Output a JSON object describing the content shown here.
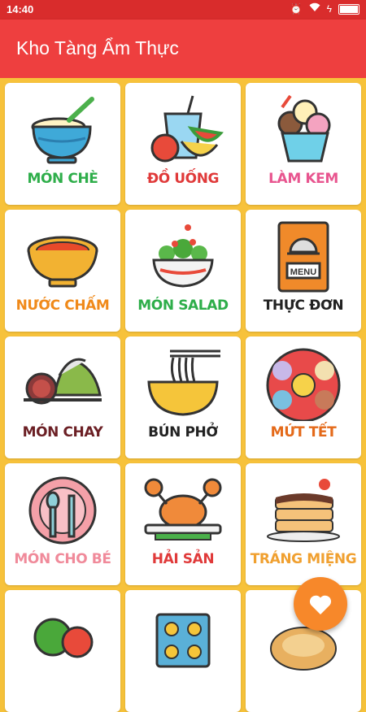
{
  "status_bar": {
    "time": "14:40"
  },
  "app_bar": {
    "title": "Kho Tàng Ẩm Thực"
  },
  "categories": [
    {
      "label": "MÓN CHÈ",
      "color": "#2eae4a",
      "icon": "dessert-bowl-icon"
    },
    {
      "label": "ĐỒ UỐNG",
      "color": "#e03a3a",
      "icon": "drink-fruit-icon"
    },
    {
      "label": "LÀM KEM",
      "color": "#e8558f",
      "icon": "ice-cream-icon"
    },
    {
      "label": "NƯỚC CHẤM",
      "color": "#f08a1a",
      "icon": "dipping-sauce-icon"
    },
    {
      "label": "MÓN SALAD",
      "color": "#2eae4a",
      "icon": "salad-bowl-icon"
    },
    {
      "label": "THỰC ĐƠN",
      "color": "#222222",
      "icon": "menu-book-icon"
    },
    {
      "label": "MÓN CHAY",
      "color": "#6b1f24",
      "icon": "vegetarian-dish-icon"
    },
    {
      "label": "BÚN PHỞ",
      "color": "#222222",
      "icon": "noodle-bowl-icon"
    },
    {
      "label": "MỨT TẾT",
      "color": "#e46a1a",
      "icon": "candy-tray-icon"
    },
    {
      "label": "MÓN CHO BÉ",
      "color": "#f08a9a",
      "icon": "baby-plate-icon"
    },
    {
      "label": "HẢI SẢN",
      "color": "#e03a3a",
      "icon": "crab-dish-icon"
    },
    {
      "label": "TRÁNG MIỆNG",
      "color": "#f0a030",
      "icon": "pancake-icon"
    }
  ],
  "fab": {
    "icon": "heart-icon"
  }
}
